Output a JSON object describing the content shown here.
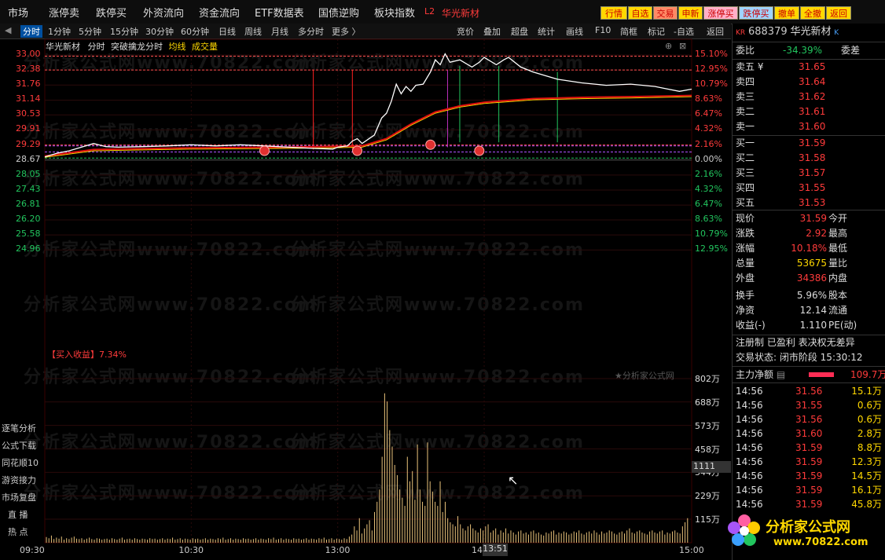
{
  "topbar": {
    "menu": [
      "市场",
      "涨停卖",
      "跌停买",
      "外资流向",
      "资金流向",
      "ETF数据表",
      "国债逆购",
      "板块指数"
    ],
    "tag": "L2",
    "stock_name": "华光新材",
    "buttons": [
      "行情",
      "自选",
      "交易",
      "申新",
      "涨停买",
      "跌停买",
      "撤单",
      "全撤",
      "返回"
    ]
  },
  "periodbar": {
    "items": [
      "分时",
      "1分钟",
      "5分钟",
      "15分钟",
      "30分钟",
      "60分钟",
      "日线",
      "周线",
      "月线",
      "多分时",
      "更多 〉"
    ],
    "tools": [
      "竞价",
      "叠加",
      "超盘",
      "统计",
      "画线",
      "F10",
      "简框",
      "标记",
      "-自选",
      "返回"
    ]
  },
  "chart_title": {
    "name": "华光新材",
    "mode": "分时",
    "indicator": "突破擒龙分时",
    "avg": "均线",
    "vol": "成交量"
  },
  "buy_profit": "【买入收益】7.34%",
  "watermark": "分析家公式网www.70822.com",
  "copyright": "★分析家公式网",
  "cursor_label": "1111",
  "time_cursor": "13:51",
  "side_menu": [
    "逐笔分析",
    "公式下载",
    "同花顺10",
    "游资接力",
    "市场复盘",
    "直  播",
    "热  点"
  ],
  "logo": {
    "title": "分析家公式网",
    "url": "www.70822.com"
  },
  "right_panel": {
    "code": "688379",
    "name": "华光新材",
    "kr_tag": "KR",
    "weibi_label": "委比",
    "weibi": "-34.39%",
    "weicha_label": "委差",
    "sells": [
      {
        "label": "卖五 ¥",
        "price": "31.65"
      },
      {
        "label": "卖四",
        "price": "31.64"
      },
      {
        "label": "卖三",
        "price": "31.62"
      },
      {
        "label": "卖二",
        "price": "31.61"
      },
      {
        "label": "卖一",
        "price": "31.60"
      }
    ],
    "buys": [
      {
        "label": "买一",
        "price": "31.59"
      },
      {
        "label": "买二",
        "price": "31.58"
      },
      {
        "label": "买三",
        "price": "31.57"
      },
      {
        "label": "买四",
        "price": "31.55"
      },
      {
        "label": "买五",
        "price": "31.53"
      }
    ],
    "quote": [
      {
        "l": "现价",
        "v": "31.59",
        "r": "今开"
      },
      {
        "l": "涨跌",
        "v": "2.92",
        "r": "最高"
      },
      {
        "l": "涨幅",
        "v": "10.18%",
        "r": "最低"
      },
      {
        "l": "总量",
        "v": "53675",
        "r": "量比"
      },
      {
        "l": "外盘",
        "v": "34386",
        "r": "内盘"
      },
      {
        "l": "换手",
        "v": "5.96%",
        "r": "股本"
      },
      {
        "l": "净资",
        "v": "12.14",
        "r": "流通"
      },
      {
        "l": "收益(-)",
        "v": "1.110",
        "r": "PE(动)"
      }
    ],
    "reg": "注册制 已盈利 表决权无差异",
    "trade_status": "交易状态: 闭市阶段 15:30:12",
    "main_flow_label": "主力净额",
    "main_flow": "109.7万",
    "ticks": [
      {
        "t": "14:56",
        "p": "31.56",
        "v": "15.1万"
      },
      {
        "t": "14:56",
        "p": "31.55",
        "v": "0.6万"
      },
      {
        "t": "14:56",
        "p": "31.56",
        "v": "0.6万"
      },
      {
        "t": "14:56",
        "p": "31.60",
        "v": "2.8万"
      },
      {
        "t": "14:56",
        "p": "31.59",
        "v": "8.8万"
      },
      {
        "t": "14:56",
        "p": "31.59",
        "v": "12.3万"
      },
      {
        "t": "14:56",
        "p": "31.59",
        "v": "14.5万"
      },
      {
        "t": "14:56",
        "p": "31.59",
        "v": "16.1万"
      },
      {
        "t": "14:56",
        "p": "31.59",
        "v": "45.8万"
      }
    ]
  },
  "chart_data": {
    "type": "line",
    "prev_close": 28.67,
    "price_ticks": [
      "33.00",
      "32.38",
      "31.76",
      "31.14",
      "30.53",
      "29.91",
      "29.29",
      "28.67",
      "28.05",
      "27.43",
      "26.81",
      "26.20",
      "25.58",
      "24.96"
    ],
    "pct_ticks": [
      "15.10%",
      "12.95%",
      "10.79%",
      "8.63%",
      "6.47%",
      "4.32%",
      "2.16%",
      "0.00%",
      "2.16%",
      "4.32%",
      "6.47%",
      "8.63%",
      "10.79%",
      "12.95%"
    ],
    "vol_ticks": [
      "802万",
      "688万",
      "573万",
      "458万",
      "344万",
      "229万",
      "115万"
    ],
    "time_ticks": [
      "09:30",
      "10:30",
      "13:00",
      "14:00",
      "15:00"
    ],
    "ylim": [
      24.96,
      33.0
    ],
    "price_series": [
      [
        0,
        28.8
      ],
      [
        5,
        28.95
      ],
      [
        10,
        29.05
      ],
      [
        15,
        29.2
      ],
      [
        20,
        29.35
      ],
      [
        25,
        29.22
      ],
      [
        30,
        29.2
      ],
      [
        40,
        29.22
      ],
      [
        50,
        29.25
      ],
      [
        60,
        29.3
      ],
      [
        70,
        29.25
      ],
      [
        80,
        29.3
      ],
      [
        90,
        29.25
      ],
      [
        100,
        29.2
      ],
      [
        110,
        29.15
      ],
      [
        118,
        29.12
      ],
      [
        120,
        29.2
      ],
      [
        124,
        29.25
      ],
      [
        126,
        29.45
      ],
      [
        128,
        29.55
      ],
      [
        130,
        29.35
      ],
      [
        135,
        29.7
      ],
      [
        138,
        30.4
      ],
      [
        140,
        30.6
      ],
      [
        142,
        31.1
      ],
      [
        144,
        31.8
      ],
      [
        146,
        31.4
      ],
      [
        148,
        31.7
      ],
      [
        150,
        31.5
      ],
      [
        152,
        31.75
      ],
      [
        155,
        31.8
      ],
      [
        158,
        32.3
      ],
      [
        160,
        32.8
      ],
      [
        162,
        32.6
      ],
      [
        164,
        33.05
      ],
      [
        166,
        32.7
      ],
      [
        170,
        32.8
      ],
      [
        175,
        32.5
      ],
      [
        178,
        32.7
      ],
      [
        180,
        32.9
      ],
      [
        185,
        32.6
      ],
      [
        188,
        32.8
      ],
      [
        190,
        32.9
      ],
      [
        195,
        32.5
      ],
      [
        200,
        32.3
      ],
      [
        210,
        32.0
      ],
      [
        220,
        31.85
      ],
      [
        230,
        31.75
      ],
      [
        240,
        31.8
      ],
      [
        250,
        31.7
      ],
      [
        255,
        31.6
      ],
      [
        260,
        31.5
      ],
      [
        265,
        31.59
      ]
    ],
    "avg_series": [
      [
        0,
        28.78
      ],
      [
        20,
        29.05
      ],
      [
        60,
        29.12
      ],
      [
        100,
        29.15
      ],
      [
        120,
        29.18
      ],
      [
        130,
        29.2
      ],
      [
        140,
        29.5
      ],
      [
        150,
        30.1
      ],
      [
        160,
        30.6
      ],
      [
        170,
        30.85
      ],
      [
        180,
        31.0
      ],
      [
        200,
        31.15
      ],
      [
        220,
        31.2
      ],
      [
        240,
        31.23
      ],
      [
        265,
        31.28
      ]
    ],
    "volume": [
      28,
      22,
      35,
      18,
      25,
      20,
      30,
      15,
      22,
      18,
      25,
      30,
      20,
      18,
      22,
      15,
      20,
      25,
      18,
      15,
      22,
      20,
      15,
      18,
      20,
      15,
      22,
      18,
      15,
      20,
      25,
      15,
      18,
      20,
      15,
      22,
      18,
      15,
      20,
      18,
      15,
      22,
      18,
      20,
      15,
      18,
      22,
      15,
      20,
      18,
      25,
      15,
      18,
      22,
      15,
      20,
      18,
      15,
      22,
      18,
      20,
      15,
      18,
      22,
      15,
      20,
      18,
      15,
      22,
      18,
      25,
      15,
      18,
      22,
      15,
      20,
      18,
      15,
      22,
      18,
      20,
      15,
      18,
      22,
      15,
      20,
      18,
      15,
      22,
      18,
      25,
      15,
      18,
      22,
      15,
      20,
      18,
      15,
      22,
      18,
      20,
      15,
      18,
      22,
      15,
      20,
      18,
      15,
      22,
      18,
      25,
      15,
      18,
      22,
      15,
      20,
      18,
      15,
      22,
      18,
      30,
      40,
      80,
      60,
      120,
      45,
      70,
      90,
      110,
      60,
      150,
      200,
      260,
      420,
      730,
      690,
      550,
      470,
      380,
      330,
      260,
      220,
      180,
      420,
      300,
      350,
      210,
      480,
      260,
      200,
      180,
      490,
      300,
      250,
      200,
      180,
      300,
      150,
      200,
      120,
      100,
      90,
      80,
      130,
      90,
      70,
      60,
      80,
      90,
      70,
      60,
      50,
      70,
      60,
      80,
      90,
      50,
      60,
      70,
      40,
      60,
      50,
      70,
      45,
      60,
      50,
      40,
      55,
      60,
      45,
      50,
      40,
      55,
      60,
      45,
      50,
      40,
      35,
      50,
      45,
      55,
      60,
      40,
      50,
      45,
      55,
      50,
      40,
      45,
      55,
      50,
      60,
      45,
      40,
      50,
      55,
      45,
      60,
      50,
      40,
      55,
      45,
      50,
      60,
      55,
      45,
      40,
      50,
      55,
      45,
      60,
      70,
      50,
      45,
      55,
      60,
      50,
      45,
      40,
      55,
      60,
      50,
      45,
      55,
      60,
      40,
      50,
      45,
      55,
      60,
      50,
      45,
      80,
      100,
      120
    ],
    "vol_max": 802
  }
}
